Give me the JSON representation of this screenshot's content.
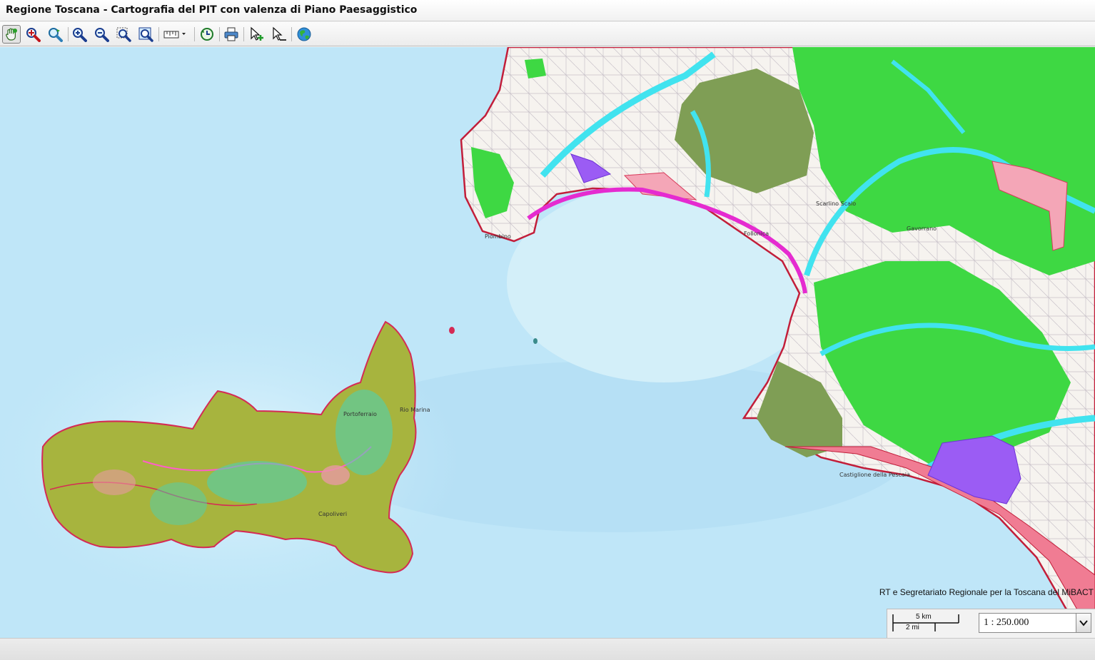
{
  "window": {
    "title": "Regione Toscana - Cartografia del PIT con valenza di Piano Paesaggistico"
  },
  "toolbar": {
    "tools": [
      {
        "name": "pan-hand-icon",
        "active": true
      },
      {
        "name": "zoom-red-icon"
      },
      {
        "name": "zoom-previous-icon"
      },
      {
        "name": "zoom-in-icon"
      },
      {
        "name": "zoom-out-icon"
      },
      {
        "name": "zoom-box-icon"
      },
      {
        "name": "zoom-extent-icon"
      },
      {
        "name": "measure-icon"
      },
      {
        "name": "refresh-icon"
      },
      {
        "name": "print-icon"
      },
      {
        "name": "select-add-icon"
      },
      {
        "name": "select-remove-icon"
      },
      {
        "name": "globe-icon"
      }
    ]
  },
  "map": {
    "sea_color": "#bfe6f8",
    "places": [
      "Piombino",
      "Follonica",
      "Scarlino Scalo",
      "Castiglione della Pescaia",
      "Portoferraio",
      "Rio Marina",
      "Capoliveri",
      "Gavorrano"
    ],
    "attribution": "RT e Segretariato Regionale per la Toscana del MiBACT",
    "scalebar": {
      "top_label": "5 km",
      "bottom_label": "2 mi"
    },
    "scale": {
      "value": "1 : 250.000"
    }
  }
}
